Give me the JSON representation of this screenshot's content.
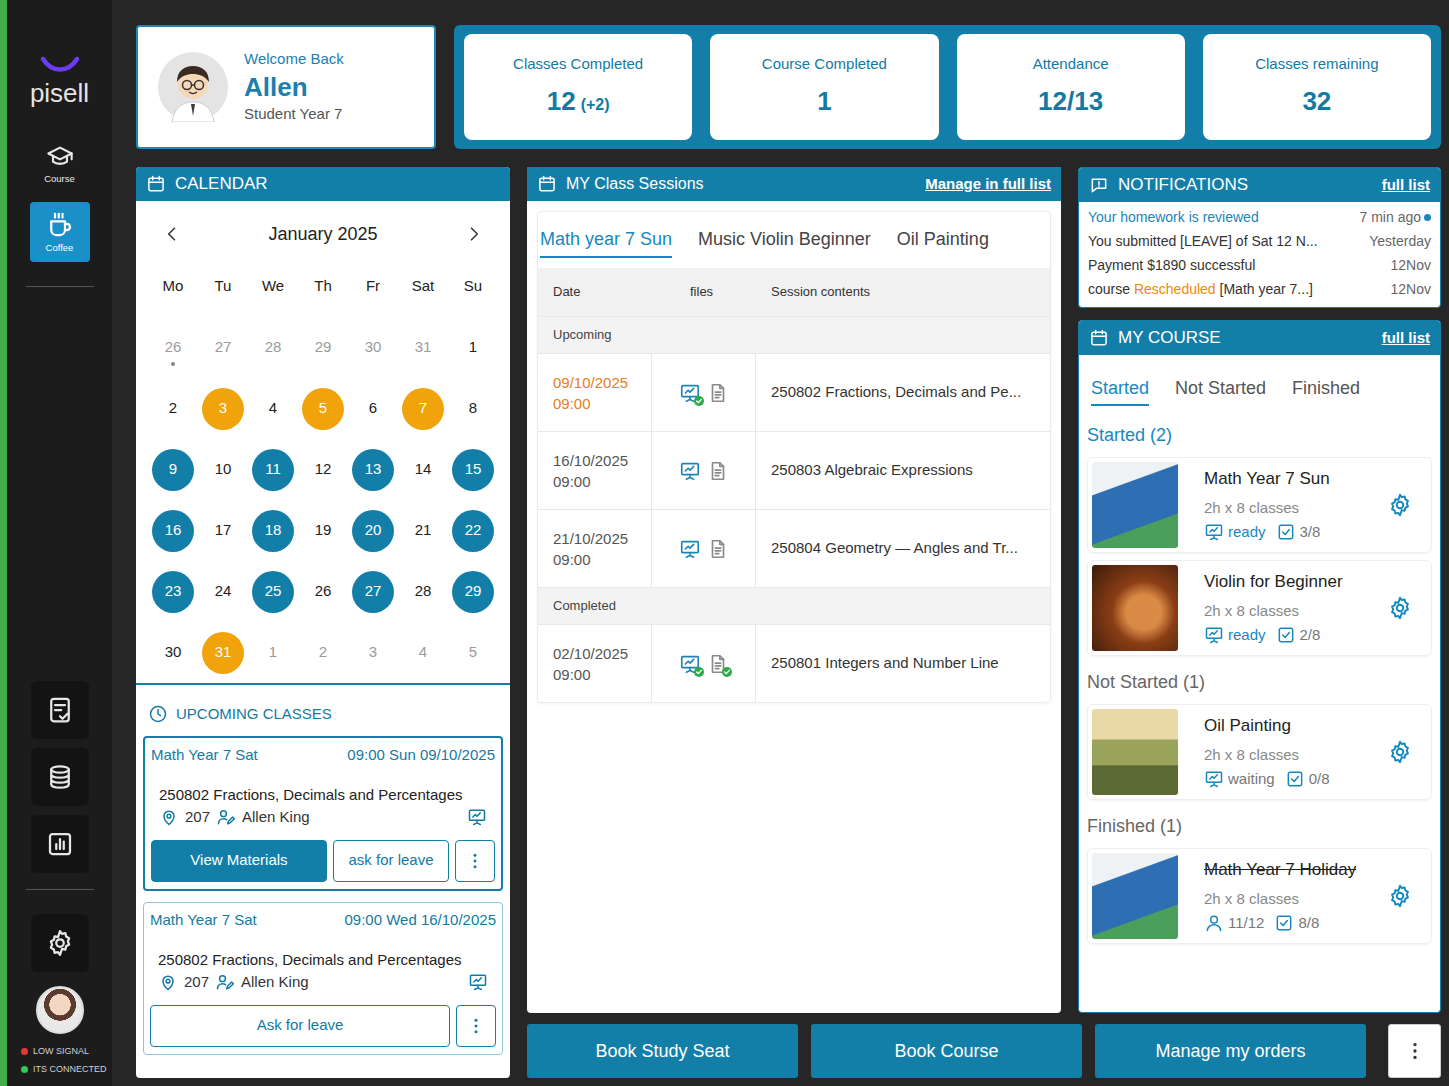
{
  "sidebar": {
    "logo": "pisell",
    "items": [
      {
        "label": "Course",
        "selected": false
      },
      {
        "label": "Coffee",
        "selected": true
      }
    ],
    "status": [
      {
        "label": "LOW SIGNAL",
        "color": "#e53935"
      },
      {
        "label": "ITS CONNECTED",
        "color": "#34c759"
      }
    ]
  },
  "profile": {
    "greeting": "Welcome Back",
    "name": "Allen",
    "role": "Student Year 7"
  },
  "stats": [
    {
      "label": "Classes Completed",
      "value": "12",
      "extra": "(+2)"
    },
    {
      "label": "Course Completed",
      "value": "1",
      "extra": ""
    },
    {
      "label": "Attendance",
      "value": "12/13",
      "extra": ""
    },
    {
      "label": "Classes remaining",
      "value": "32",
      "extra": ""
    }
  ],
  "calendar": {
    "title": "CALENDAR",
    "month": "January 2025",
    "weekdays": [
      "Mo",
      "Tu",
      "We",
      "Th",
      "Fr",
      "Sat",
      "Su"
    ],
    "days": [
      {
        "day": "26",
        "muted": true,
        "dot": true,
        "color": null
      },
      {
        "day": "27",
        "muted": true,
        "dot": false,
        "color": null
      },
      {
        "day": "28",
        "muted": true,
        "dot": false,
        "color": null
      },
      {
        "day": "29",
        "muted": true,
        "dot": false,
        "color": null
      },
      {
        "day": "30",
        "muted": true,
        "dot": false,
        "color": null
      },
      {
        "day": "31",
        "muted": true,
        "dot": false,
        "color": null
      },
      {
        "day": "1",
        "muted": false,
        "dot": false,
        "color": null
      },
      {
        "day": "2",
        "muted": false,
        "dot": false,
        "color": null
      },
      {
        "day": "3",
        "muted": false,
        "dot": false,
        "color": "#f0a30a"
      },
      {
        "day": "4",
        "muted": false,
        "dot": false,
        "color": null
      },
      {
        "day": "5",
        "muted": false,
        "dot": false,
        "color": "#f0a30a"
      },
      {
        "day": "6",
        "muted": false,
        "dot": false,
        "color": null
      },
      {
        "day": "7",
        "muted": false,
        "dot": false,
        "color": "#f0a30a"
      },
      {
        "day": "8",
        "muted": false,
        "dot": false,
        "color": null
      },
      {
        "day": "9",
        "muted": false,
        "dot": false,
        "color": "#137fa8"
      },
      {
        "day": "10",
        "muted": false,
        "dot": false,
        "color": null
      },
      {
        "day": "11",
        "muted": false,
        "dot": false,
        "color": "#137fa8"
      },
      {
        "day": "12",
        "muted": false,
        "dot": false,
        "color": null
      },
      {
        "day": "13",
        "muted": false,
        "dot": false,
        "color": "#137fa8"
      },
      {
        "day": "14",
        "muted": false,
        "dot": false,
        "color": null
      },
      {
        "day": "15",
        "muted": false,
        "dot": false,
        "color": "#137fa8"
      },
      {
        "day": "16",
        "muted": false,
        "dot": false,
        "color": "#137fa8"
      },
      {
        "day": "17",
        "muted": false,
        "dot": false,
        "color": null
      },
      {
        "day": "18",
        "muted": false,
        "dot": false,
        "color": "#137fa8"
      },
      {
        "day": "19",
        "muted": false,
        "dot": false,
        "color": null
      },
      {
        "day": "20",
        "muted": false,
        "dot": false,
        "color": "#137fa8"
      },
      {
        "day": "21",
        "muted": false,
        "dot": false,
        "color": null
      },
      {
        "day": "22",
        "muted": false,
        "dot": false,
        "color": "#137fa8"
      },
      {
        "day": "23",
        "muted": false,
        "dot": false,
        "color": "#137fa8"
      },
      {
        "day": "24",
        "muted": false,
        "dot": false,
        "color": null
      },
      {
        "day": "25",
        "muted": false,
        "dot": false,
        "color": "#137fa8"
      },
      {
        "day": "26",
        "muted": false,
        "dot": false,
        "color": null
      },
      {
        "day": "27",
        "muted": false,
        "dot": false,
        "color": "#137fa8"
      },
      {
        "day": "28",
        "muted": false,
        "dot": false,
        "color": null
      },
      {
        "day": "29",
        "muted": false,
        "dot": false,
        "color": "#137fa8"
      },
      {
        "day": "30",
        "muted": false,
        "dot": false,
        "color": null
      },
      {
        "day": "31",
        "muted": false,
        "dot": false,
        "color": "#f0a30a"
      },
      {
        "day": "1",
        "muted": true,
        "dot": false,
        "color": null
      },
      {
        "day": "2",
        "muted": true,
        "dot": false,
        "color": null
      },
      {
        "day": "3",
        "muted": true,
        "dot": false,
        "color": null
      },
      {
        "day": "4",
        "muted": true,
        "dot": false,
        "color": null
      },
      {
        "day": "5",
        "muted": true,
        "dot": false,
        "color": null
      }
    ]
  },
  "upcoming": {
    "title": "UPCOMING CLASSES",
    "items": [
      {
        "course": "Math Year 7 Sat",
        "time": "09:00 Sun 09/10/2025",
        "topic": "250802 Fractions, Decimals and Percentages",
        "room": "207",
        "teacher": "Allen King",
        "selected": true,
        "buttons": [
          {
            "label": "View Materials",
            "primary": true
          },
          {
            "label": "ask for leave",
            "primary": false
          }
        ]
      },
      {
        "course": "Math Year 7 Sat",
        "time": "09:00 Wed 16/10/2025",
        "topic": "250802 Fractions, Decimals and Percentages",
        "room": "207",
        "teacher": "Allen King",
        "selected": false,
        "buttons": [
          {
            "label": "Ask for leave",
            "primary": false
          }
        ]
      }
    ]
  },
  "sessions": {
    "title": "MY Class Sessions",
    "link": "Manage in full list",
    "tabs": [
      {
        "label": "Math year 7 Sun",
        "selected": true
      },
      {
        "label": "Music Violin Beginner",
        "selected": false
      },
      {
        "label": "Oil Painting",
        "selected": false
      }
    ],
    "columns": [
      "Date",
      "files",
      "Session contents"
    ],
    "groups": [
      {
        "label": "Upcoming",
        "rows": [
          {
            "date": "09/10/2025",
            "time": "09:00",
            "due": true,
            "files": [
              {
                "kind": "slides",
                "checked": true
              },
              {
                "kind": "document",
                "checked": false
              }
            ],
            "content": "250802 Fractions, Decimals and Pe..."
          },
          {
            "date": "16/10/2025",
            "time": "09:00",
            "due": false,
            "files": [
              {
                "kind": "slides",
                "checked": false
              },
              {
                "kind": "document",
                "checked": false
              }
            ],
            "content": "250803 Algebraic Expressions"
          },
          {
            "date": "21/10/2025",
            "time": "09:00",
            "due": false,
            "files": [
              {
                "kind": "slides",
                "checked": false
              },
              {
                "kind": "document",
                "checked": false
              }
            ],
            "content": "250804 Geometry — Angles and Tr..."
          }
        ]
      },
      {
        "label": "Completed",
        "rows": [
          {
            "date": "02/10/2025",
            "time": "09:00",
            "due": false,
            "files": [
              {
                "kind": "slides",
                "checked": true
              },
              {
                "kind": "document",
                "checked": true
              }
            ],
            "content": "250801 Integers and Number Line"
          }
        ]
      }
    ]
  },
  "notifications": {
    "title": "NOTIFICATIONS",
    "link": "full list",
    "items": [
      {
        "segments": [
          {
            "text": "Your homework is reviewed",
            "emphasis": false
          }
        ],
        "time": "7 min ago",
        "unread": true
      },
      {
        "segments": [
          {
            "text": "You submitted [LEAVE] of Sat 12 N...",
            "emphasis": false
          }
        ],
        "time": "Yesterday",
        "unread": false
      },
      {
        "segments": [
          {
            "text": "Payment $1890 successful",
            "emphasis": false
          }
        ],
        "time": "12Nov",
        "unread": false
      },
      {
        "segments": [
          {
            "text": "course ",
            "emphasis": false
          },
          {
            "text": "Rescheduled",
            "emphasis": true
          },
          {
            "text": " [Math year 7...]",
            "emphasis": false
          }
        ],
        "time": "12Nov",
        "unread": false
      }
    ]
  },
  "courses": {
    "title": "MY COURSE",
    "link": "full list",
    "tabs": [
      {
        "label": "Started",
        "selected": true
      },
      {
        "label": "Not Started",
        "selected": false
      },
      {
        "label": "Finished",
        "selected": false
      }
    ],
    "groups": [
      {
        "label": "Started (2)",
        "selected": true,
        "items": [
          {
            "name": "Math Year 7 Sun",
            "meta": "2h x 8 classes",
            "status": "ready",
            "ready": true,
            "progress": "3/8",
            "finished": false,
            "kind": "math"
          },
          {
            "name": "Violin for Beginner",
            "meta": "2h x 8 classes",
            "status": "ready",
            "ready": true,
            "progress": "2/8",
            "finished": false,
            "kind": "violin"
          }
        ]
      },
      {
        "label": "Not Started (1)",
        "selected": false,
        "items": [
          {
            "name": "Oil Painting",
            "meta": "2h x 8 classes",
            "status": "waiting",
            "ready": false,
            "progress": "0/8",
            "finished": false,
            "kind": "painting"
          }
        ]
      },
      {
        "label": "Finished (1)",
        "selected": false,
        "items": [
          {
            "name": "Math Year 7 Holiday",
            "meta": "2h x 8 classes",
            "status": "11/12",
            "ready": false,
            "progress": "8/8",
            "finished": true,
            "kind": "math"
          }
        ]
      }
    ]
  },
  "actions": [
    "Book Study Seat",
    "Book Course",
    "Manage my orders"
  ]
}
